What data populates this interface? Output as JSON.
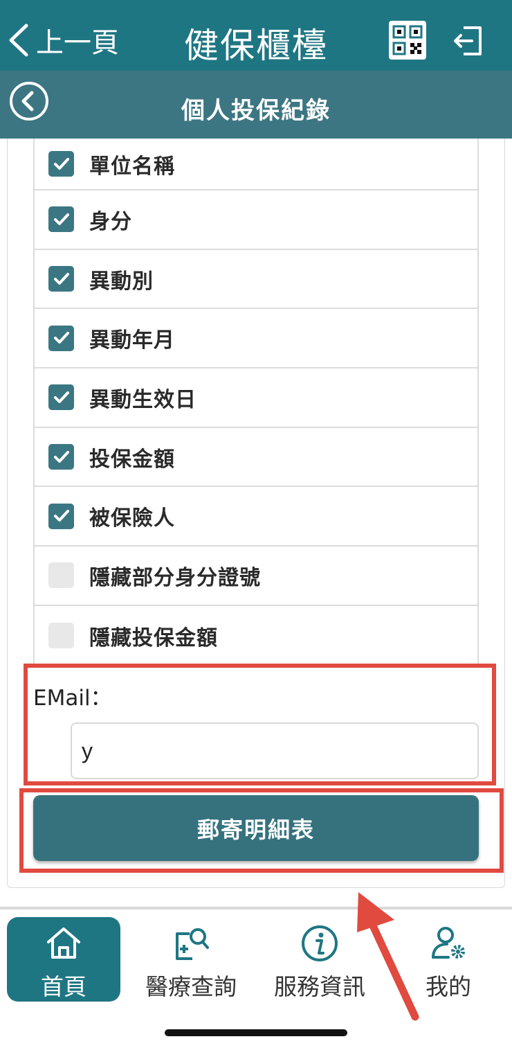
{
  "header": {
    "back_label": "上一頁",
    "title": "健保櫃檯"
  },
  "subheader": {
    "title": "個人投保紀錄"
  },
  "options": [
    {
      "label": "單位名稱",
      "checked": true
    },
    {
      "label": "身分",
      "checked": true
    },
    {
      "label": "異動別",
      "checked": true
    },
    {
      "label": "異動年月",
      "checked": true
    },
    {
      "label": "異動生效日",
      "checked": true
    },
    {
      "label": "投保金額",
      "checked": true
    },
    {
      "label": "被保險人",
      "checked": true
    },
    {
      "label": "隱藏部分身分證號",
      "checked": false
    },
    {
      "label": "隱藏投保金額",
      "checked": false
    }
  ],
  "email": {
    "label": "EMail：",
    "value": "y"
  },
  "submit_label": "郵寄明細表",
  "bottom_nav": [
    {
      "label": "首頁",
      "icon": "home-icon",
      "active": true
    },
    {
      "label": "醫療查詢",
      "icon": "medical-search-icon",
      "active": false
    },
    {
      "label": "服務資訊",
      "icon": "info-icon",
      "active": false
    },
    {
      "label": "我的",
      "icon": "user-settings-icon",
      "active": false
    }
  ],
  "colors": {
    "primary": "#1f7683",
    "secondary": "#3c7682",
    "highlight": "#e04a3f"
  }
}
